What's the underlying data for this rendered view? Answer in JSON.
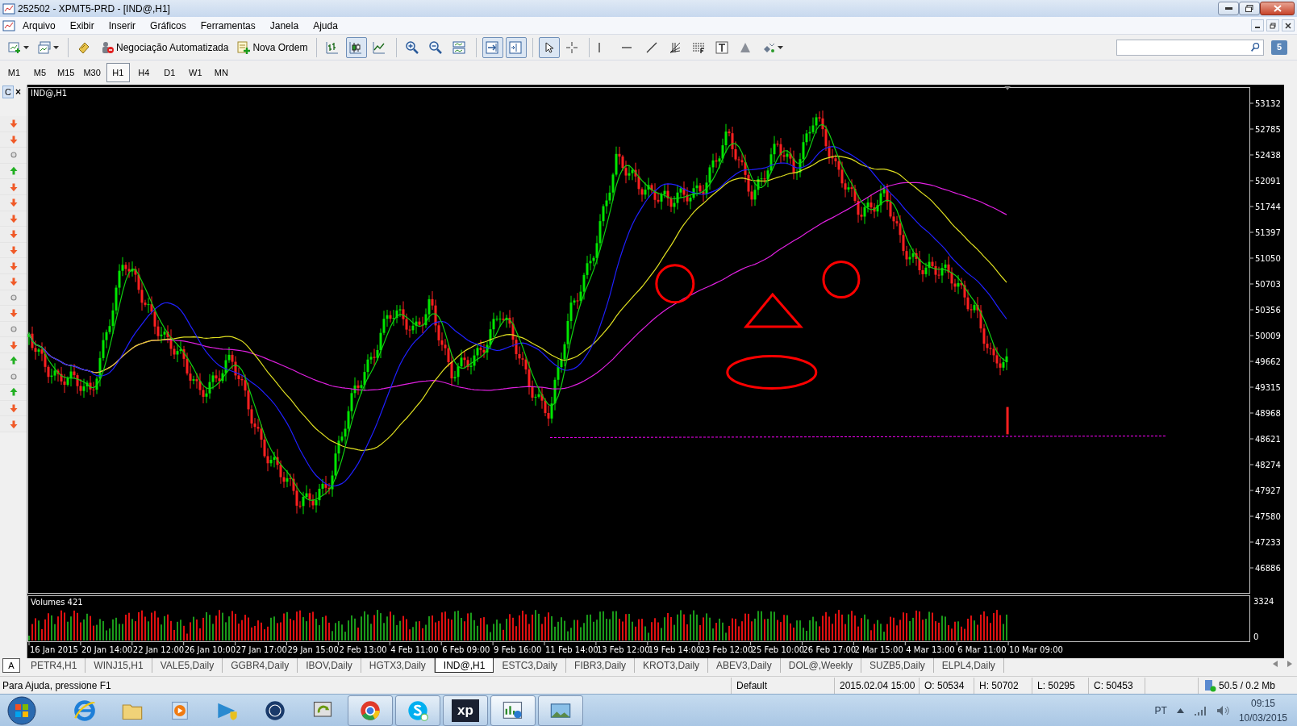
{
  "window": {
    "title": "252502 - XPMT5-PRD - [IND@,H1]"
  },
  "menu": [
    {
      "label": "Arquivo"
    },
    {
      "label": "Exibir"
    },
    {
      "label": "Inserir"
    },
    {
      "label": "Gráficos"
    },
    {
      "label": "Ferramentas"
    },
    {
      "label": "Janela"
    },
    {
      "label": "Ajuda"
    }
  ],
  "toolbar": [
    {
      "kind": "new-chart",
      "pressed": false,
      "dropdown": true
    },
    {
      "kind": "profiles",
      "pressed": false,
      "dropdown": true
    },
    {
      "kind": "separator"
    },
    {
      "kind": "strategy",
      "pressed": false,
      "dropdown": false
    },
    {
      "kind": "auto-trading",
      "pressed": false,
      "dropdown": false,
      "label": "Negociação Automatizada"
    },
    {
      "kind": "new-order",
      "pressed": false,
      "dropdown": false,
      "label": "Nova Ordem"
    },
    {
      "kind": "separator"
    },
    {
      "kind": "bar-chart",
      "pressed": false,
      "dropdown": false
    },
    {
      "kind": "candle-chart",
      "pressed": true,
      "dropdown": false
    },
    {
      "kind": "line-chart",
      "pressed": false,
      "dropdown": false
    },
    {
      "kind": "separator"
    },
    {
      "kind": "zoom-in",
      "pressed": false,
      "dropdown": false
    },
    {
      "kind": "zoom-out",
      "pressed": false,
      "dropdown": false
    },
    {
      "kind": "tile",
      "pressed": false,
      "dropdown": false
    },
    {
      "kind": "separator"
    },
    {
      "kind": "autoscroll",
      "pressed": true,
      "dropdown": false
    },
    {
      "kind": "chart-shift",
      "pressed": true,
      "dropdown": false
    },
    {
      "kind": "separator"
    },
    {
      "kind": "cursor",
      "pressed": true,
      "dropdown": false
    },
    {
      "kind": "crosshair",
      "pressed": false,
      "dropdown": false
    },
    {
      "kind": "separator"
    },
    {
      "kind": "vertical-line",
      "pressed": false,
      "dropdown": false
    },
    {
      "kind": "horizontal-line",
      "pressed": false,
      "dropdown": false
    },
    {
      "kind": "trend-line",
      "pressed": false,
      "dropdown": false
    },
    {
      "kind": "fibo-fan",
      "pressed": false,
      "dropdown": false
    },
    {
      "kind": "fibo-levels",
      "pressed": false,
      "dropdown": false
    },
    {
      "kind": "text",
      "pressed": false,
      "dropdown": false
    },
    {
      "kind": "triangle",
      "pressed": false,
      "dropdown": false
    },
    {
      "kind": "shapes",
      "pressed": false,
      "dropdown": true
    }
  ],
  "community_badge": "5",
  "timeframes": [
    {
      "label": "M1",
      "selected": false
    },
    {
      "label": "M5",
      "selected": false
    },
    {
      "label": "M15",
      "selected": false
    },
    {
      "label": "M30",
      "selected": false
    },
    {
      "label": "H1",
      "selected": true
    },
    {
      "label": "H4",
      "selected": false
    },
    {
      "label": "D1",
      "selected": false
    },
    {
      "label": "W1",
      "selected": false
    },
    {
      "label": "MN",
      "selected": false
    }
  ],
  "signals_panel": {
    "title": "C",
    "close": "×",
    "signals": [
      {
        "kind": "down"
      },
      {
        "kind": "down"
      },
      {
        "kind": "neutral"
      },
      {
        "kind": "up"
      },
      {
        "kind": "down"
      },
      {
        "kind": "down"
      },
      {
        "kind": "down"
      },
      {
        "kind": "down"
      },
      {
        "kind": "down"
      },
      {
        "kind": "down"
      },
      {
        "kind": "down"
      },
      {
        "kind": "neutral"
      },
      {
        "kind": "down"
      },
      {
        "kind": "neutral"
      },
      {
        "kind": "down"
      },
      {
        "kind": "up"
      },
      {
        "kind": "neutral"
      },
      {
        "kind": "up"
      },
      {
        "kind": "down"
      },
      {
        "kind": "down"
      }
    ]
  },
  "chart": {
    "title": "IND@,H1",
    "price_labels": [
      "53132",
      "52785",
      "52438",
      "52091",
      "51744",
      "51397",
      "51050",
      "50703",
      "50356",
      "50009",
      "49662",
      "49315",
      "48968",
      "48621",
      "48274",
      "47927",
      "47580",
      "47233",
      "46886"
    ],
    "volume_title": "Volumes 421",
    "volume_labels": [
      "3324",
      "0"
    ],
    "time_labels": [
      "16 Jan 2015",
      "20 Jan 14:00",
      "22 Jan 12:00",
      "26 Jan 10:00",
      "27 Jan 17:00",
      "29 Jan 15:00",
      "2 Feb 13:00",
      "4 Feb 11:00",
      "6 Feb 09:00",
      "9 Feb 16:00",
      "11 Feb 14:00",
      "13 Feb 12:00",
      "19 Feb 14:00",
      "23 Feb 12:00",
      "25 Feb 10:00",
      "26 Feb 17:00",
      "2 Mar 15:00",
      "4 Mar 13:00",
      "6 Mar 11:00",
      "10 Mar 09:00"
    ]
  },
  "side_tab": "A",
  "chart_tabs": [
    {
      "label": "PETR4,H1",
      "selected": false
    },
    {
      "label": "WINJ15,H1",
      "selected": false
    },
    {
      "label": "VALE5,Daily",
      "selected": false
    },
    {
      "label": "GGBR4,Daily",
      "selected": false
    },
    {
      "label": "IBOV,Daily",
      "selected": false
    },
    {
      "label": "HGTX3,Daily",
      "selected": false
    },
    {
      "label": "IND@,H1",
      "selected": true
    },
    {
      "label": "ESTC3,Daily",
      "selected": false
    },
    {
      "label": "FIBR3,Daily",
      "selected": false
    },
    {
      "label": "KROT3,Daily",
      "selected": false
    },
    {
      "label": "ABEV3,Daily",
      "selected": false
    },
    {
      "label": "DOL@,Weekly",
      "selected": false
    },
    {
      "label": "SUZB5,Daily",
      "selected": false
    },
    {
      "label": "ELPL4,Daily",
      "selected": false
    }
  ],
  "status_bar": {
    "help": "Para Ajuda, pressione F1",
    "profile": "Default",
    "time": "2015.02.04 15:00",
    "open": "O: 50534",
    "high": "H: 50702",
    "low": "L: 50295",
    "close": "C: 50453",
    "traffic": "50.5 / 0.2 Mb"
  },
  "taskbar": {
    "apps": [
      {
        "kind": "ie",
        "running": false,
        "active": false
      },
      {
        "kind": "explorer",
        "running": false,
        "active": false
      },
      {
        "kind": "media",
        "running": false,
        "active": false
      },
      {
        "kind": "shield-arrow",
        "running": false,
        "active": false
      },
      {
        "kind": "hp",
        "running": false,
        "active": false
      },
      {
        "kind": "sync",
        "running": false,
        "active": false
      },
      {
        "kind": "chrome",
        "running": true,
        "active": false
      },
      {
        "kind": "skype",
        "running": true,
        "active": false
      },
      {
        "kind": "xp",
        "running": true,
        "active": false,
        "label": "xp"
      },
      {
        "kind": "trader",
        "running": true,
        "active": true
      },
      {
        "kind": "photos",
        "running": true,
        "active": false
      }
    ],
    "language": "PT",
    "time": "09:15",
    "date": "10/03/2015"
  }
}
